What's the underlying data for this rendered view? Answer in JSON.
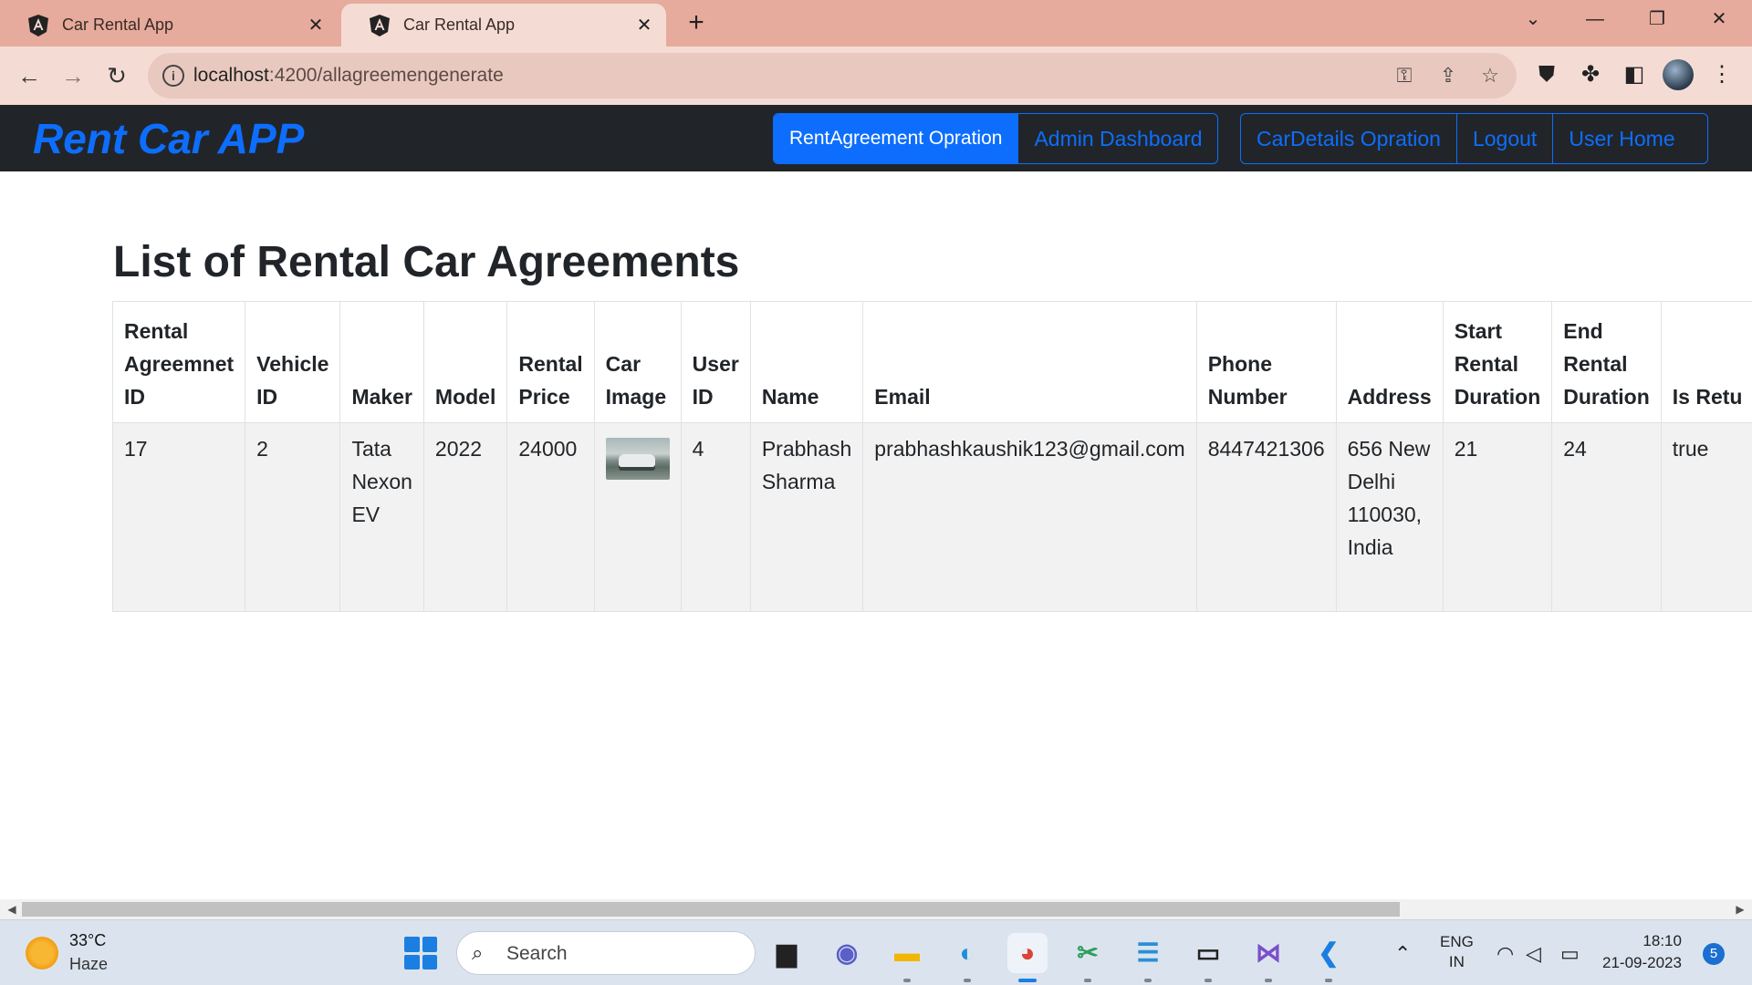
{
  "browser": {
    "tabs": [
      {
        "title": "Car Rental App",
        "active": false
      },
      {
        "title": "Car Rental App",
        "active": true
      }
    ],
    "url_host": "localhost",
    "url_path": ":4200/allagreemengenerate"
  },
  "navbar": {
    "brand": "Rent Car APP",
    "group_left": [
      "RentAgreement Opration",
      "Admin Dashboard"
    ],
    "group_right": [
      "CarDetails Opration",
      "Logout",
      "User Home"
    ],
    "accent_color": "#0d6efd",
    "background_color": "#212529"
  },
  "page": {
    "title": "List of Rental Car Agreements"
  },
  "table": {
    "headers": [
      "Rental Agreemnet ID",
      "Vehicle ID",
      "Maker",
      "Model",
      "Rental Price",
      "Car Image",
      "User ID",
      "Name",
      "Email",
      "Phone Number",
      "Address",
      "Start Rental Duration",
      "End Rental Duration",
      "Is Retu"
    ],
    "rows": [
      {
        "rental_agreement_id": "17",
        "vehicle_id": "2",
        "maker": "Tata Nexon EV",
        "model": "2022",
        "rental_price": "24000",
        "car_image": "car-photo",
        "user_id": "4",
        "name": "Prabhash Sharma",
        "email": "prabhashkaushik123@gmail.com",
        "phone_number": "8447421306",
        "address": "656 New Delhi 110030, India",
        "start_rental_duration": "21",
        "end_rental_duration": "24",
        "is_returned": "true"
      }
    ]
  },
  "taskbar": {
    "weather_temp": "33°C",
    "weather_desc": "Haze",
    "search_placeholder": "Search",
    "lang_line1": "ENG",
    "lang_line2": "IN",
    "time": "18:10",
    "date": "21-09-2023",
    "notification_count": "5"
  },
  "icons": {
    "tab_favicon": "angular-logo-icon",
    "taskbar_apps": [
      "task-view-icon",
      "chat-icon",
      "file-explorer-icon",
      "edge-icon",
      "chrome-icon",
      "snipping-tool-icon",
      "notepad-icon",
      "terminal-icon",
      "visual-studio-icon",
      "vscode-icon"
    ]
  }
}
